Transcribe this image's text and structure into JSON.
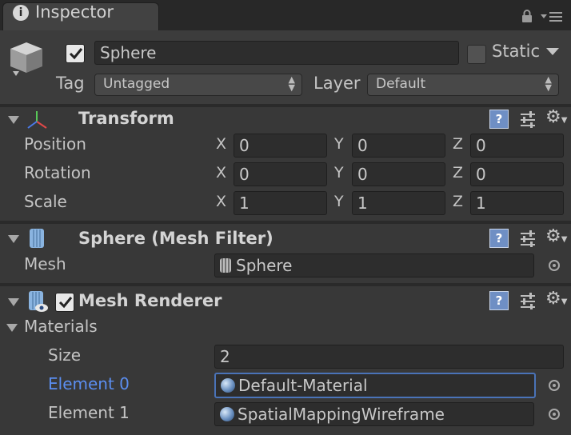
{
  "tab": {
    "title": "Inspector"
  },
  "header": {
    "object_active": true,
    "object_name": "Sphere",
    "static_label": "Static",
    "static_checked": false,
    "tag_label": "Tag",
    "tag_value": "Untagged",
    "layer_label": "Layer",
    "layer_value": "Default"
  },
  "transform": {
    "title": "Transform",
    "rows": [
      {
        "label": "Position",
        "x": "0",
        "y": "0",
        "z": "0"
      },
      {
        "label": "Rotation",
        "x": "0",
        "y": "0",
        "z": "0"
      },
      {
        "label": "Scale",
        "x": "1",
        "y": "1",
        "z": "1"
      }
    ],
    "axis_labels": {
      "x": "X",
      "y": "Y",
      "z": "Z"
    }
  },
  "mesh_filter": {
    "title": "Sphere (Mesh Filter)",
    "mesh_label": "Mesh",
    "mesh_value": "Sphere"
  },
  "mesh_renderer": {
    "title": "Mesh Renderer",
    "enabled": true,
    "materials_label": "Materials",
    "size_label": "Size",
    "size_value": "2",
    "elements": [
      {
        "label": "Element 0",
        "value": "Default-Material",
        "selected": true
      },
      {
        "label": "Element 1",
        "value": "SpatialMappingWireframe",
        "selected": false
      }
    ]
  },
  "icons": {
    "help": "?",
    "gear": "⚙"
  },
  "colors": {
    "background": "#383838",
    "selected_label": "#5b8ef0",
    "selected_border": "#4a73b8",
    "help_icon": "#6f8fc4"
  }
}
